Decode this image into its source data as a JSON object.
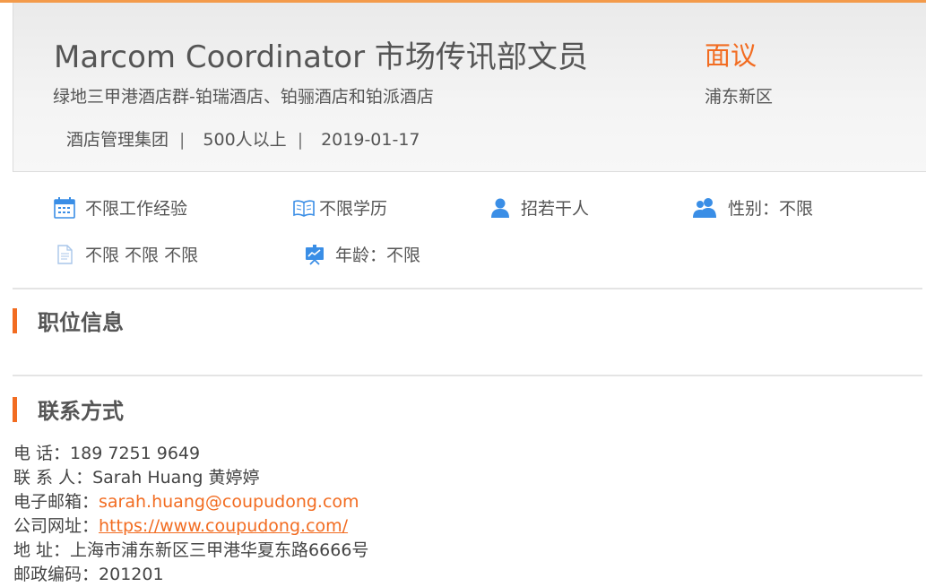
{
  "job": {
    "title": "Marcom Coordinator 市场传讯部文员",
    "salary": "面议",
    "company": "绿地三甲港酒店群-铂瑞酒店、铂骊酒店和铂派酒店",
    "district": "浦东新区",
    "industry": "酒店管理集团",
    "size": "500人以上",
    "date": "2019-01-17",
    "separator": "|"
  },
  "requirements": [
    {
      "icon": "calendar-icon",
      "label": "不限工作经验"
    },
    {
      "icon": "book-icon",
      "label": "不限学历"
    },
    {
      "icon": "person-icon",
      "label": "招若干人"
    },
    {
      "icon": "people-icon",
      "label": "性别：不限"
    },
    {
      "icon": "document-icon",
      "label": "不限 不限 不限"
    },
    {
      "icon": "presentation-icon",
      "label": "年龄：不限"
    }
  ],
  "sections": {
    "job_info": "职位信息",
    "contact": "联系方式"
  },
  "contact": {
    "phone_label": "电 话：",
    "phone": "189 7251 9649",
    "person_label": "联 系 人：",
    "person": "Sarah Huang 黄婷婷",
    "email_label": "电子邮箱：",
    "email": "sarah.huang@coupudong.com",
    "website_label": "公司网址：",
    "website": "https://www.coupudong.com/",
    "address_label": "地 址：",
    "address": "上海市浦东新区三甲港华夏东路6666号",
    "zip_label": "邮政编码：",
    "zip": "201201"
  },
  "colors": {
    "accent": "#f26c21",
    "icon_blue": "#3a8ee6",
    "text": "#555555"
  }
}
